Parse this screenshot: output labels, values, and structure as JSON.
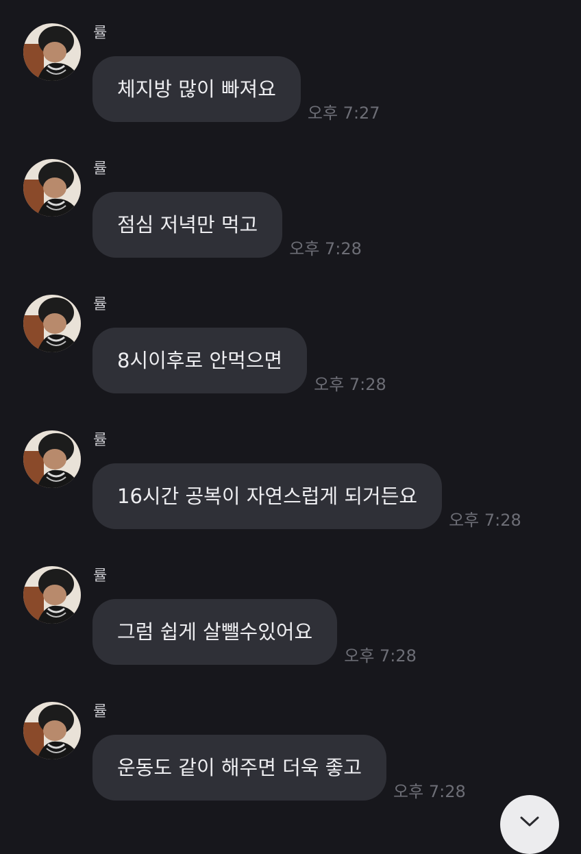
{
  "chat": {
    "messages": [
      {
        "sender": "률",
        "text": "체지방 많이 빠져요",
        "time": "오후 7:27"
      },
      {
        "sender": "률",
        "text": "점심 저녁만 먹고",
        "time": "오후 7:28"
      },
      {
        "sender": "률",
        "text": "8시이후로 안먹으면",
        "time": "오후 7:28"
      },
      {
        "sender": "률",
        "text": "16시간 공복이 자연스럽게 되거든요",
        "time": "오후 7:28"
      },
      {
        "sender": "률",
        "text": "그럼 쉽게 살뺄수있어요",
        "time": "오후 7:28"
      },
      {
        "sender": "률",
        "text": "운동도 같이 해주면 더욱 좋고",
        "time": "오후 7:28"
      }
    ]
  },
  "icons": {
    "avatar": "profile-photo",
    "scroll_down": "chevron-down-icon"
  },
  "colors": {
    "background": "#17171c",
    "bubble": "#2f3037",
    "text": "#ededf0",
    "time": "#6d6e76",
    "scroll_button": "#ececee"
  }
}
